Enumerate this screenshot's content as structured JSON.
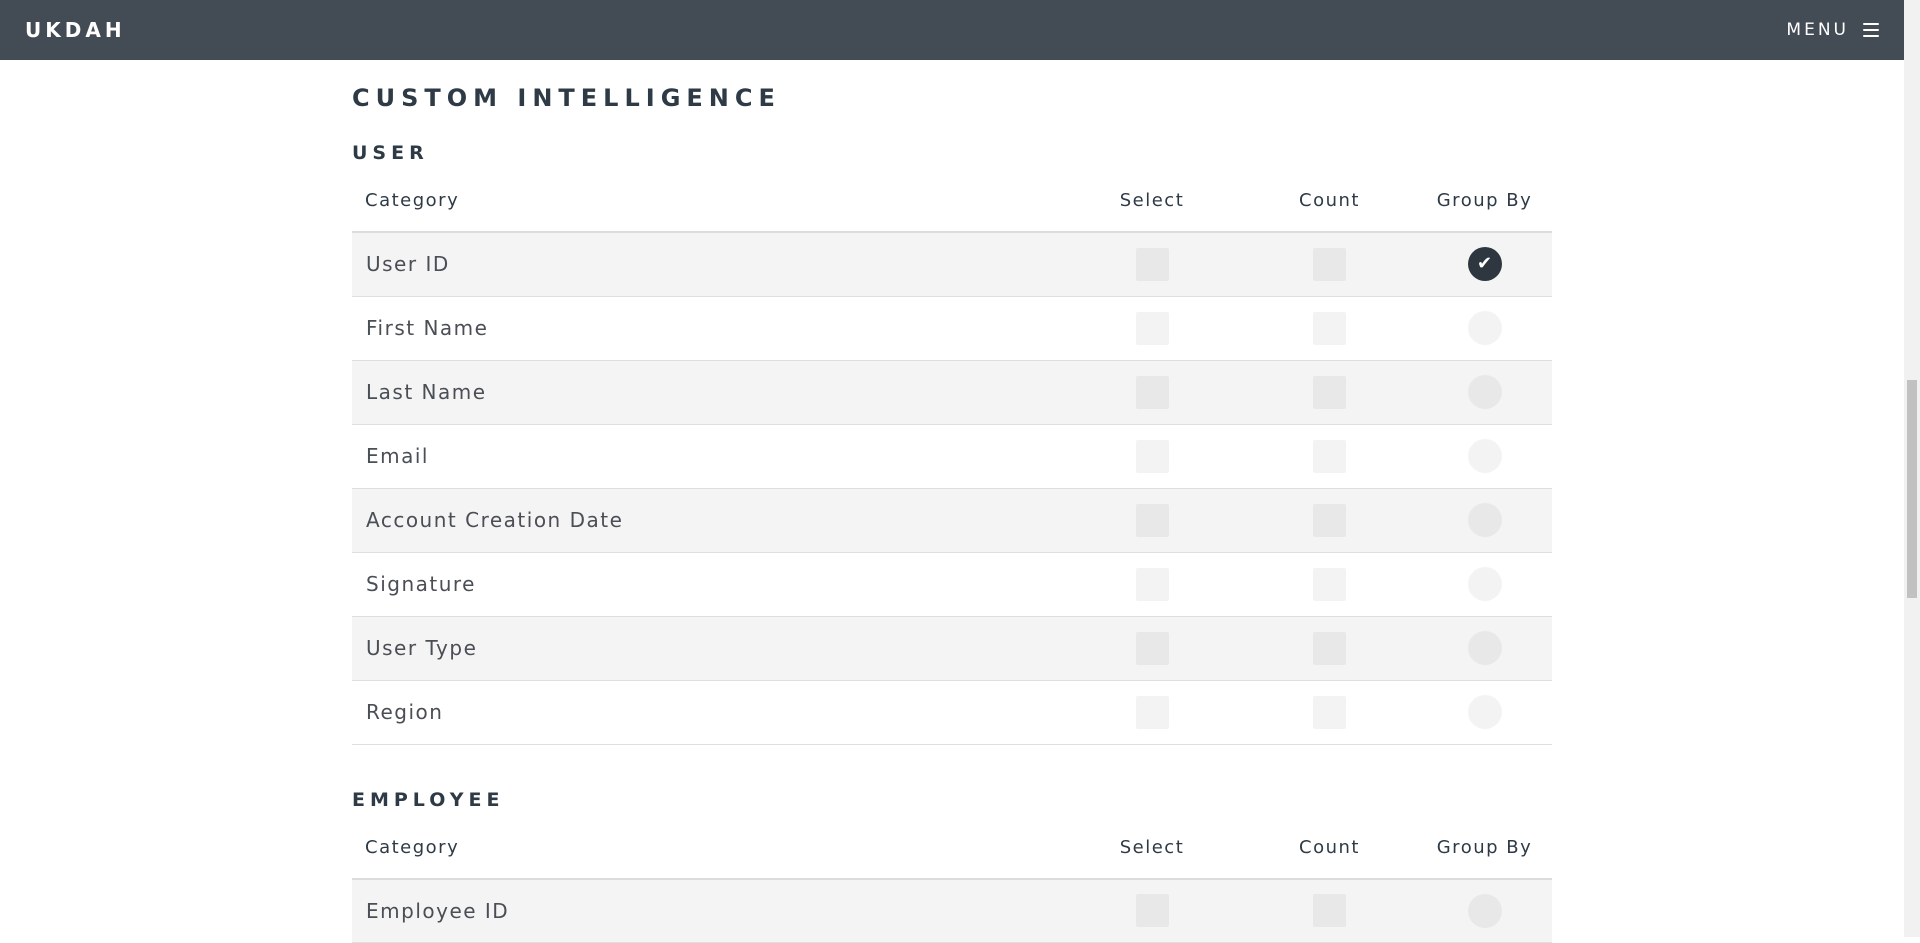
{
  "header": {
    "brand": "UKDAH",
    "menu_label": "MENU",
    "menu_icon": "hamburger-icon"
  },
  "page": {
    "title": "CUSTOM INTELLIGENCE"
  },
  "sections": [
    {
      "title": "USER",
      "columns": [
        "Category",
        "Select",
        "Count",
        "Group By"
      ],
      "rows": [
        {
          "label": "User ID",
          "select": false,
          "count": false,
          "group_by": true
        },
        {
          "label": "First Name",
          "select": false,
          "count": false,
          "group_by": false
        },
        {
          "label": "Last Name",
          "select": false,
          "count": false,
          "group_by": false
        },
        {
          "label": "Email",
          "select": false,
          "count": false,
          "group_by": false
        },
        {
          "label": "Account Creation Date",
          "select": false,
          "count": false,
          "group_by": false
        },
        {
          "label": "Signature",
          "select": false,
          "count": false,
          "group_by": false
        },
        {
          "label": "User Type",
          "select": false,
          "count": false,
          "group_by": false
        },
        {
          "label": "Region",
          "select": false,
          "count": false,
          "group_by": false
        }
      ]
    },
    {
      "title": "EMPLOYEE",
      "columns": [
        "Category",
        "Select",
        "Count",
        "Group By"
      ],
      "rows": [
        {
          "label": "Employee ID",
          "select": false,
          "count": false,
          "group_by": false
        }
      ]
    }
  ],
  "colors": {
    "header_bg": "#434c54",
    "heading_text": "#2e3a45",
    "checked_radio": "#2e3640"
  }
}
